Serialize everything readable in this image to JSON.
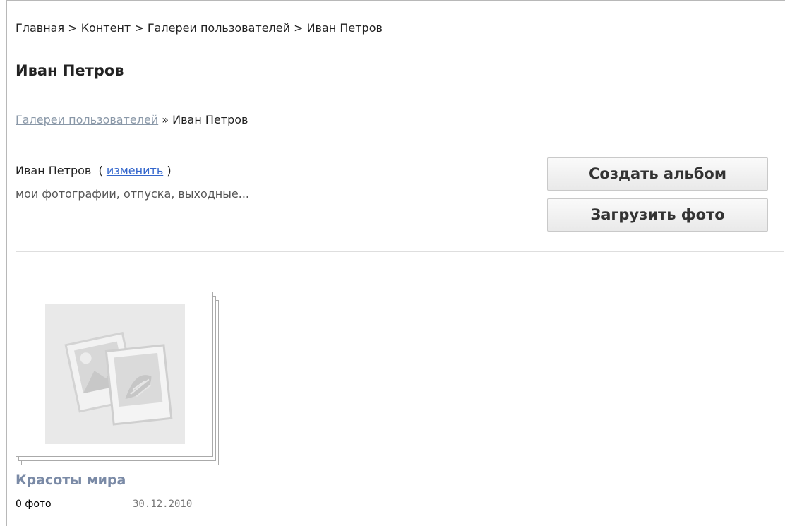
{
  "breadcrumb": {
    "text": "Главная > Контент > Галереи пользователей > Иван Петров"
  },
  "page": {
    "title": "Иван Петров"
  },
  "gallery_crumb": {
    "link_label": "Галереи пользователей",
    "separator": " » ",
    "current": "Иван Петров"
  },
  "owner": {
    "name": "Иван Петров",
    "open_paren": "  ( ",
    "edit_label": "изменить",
    "close_paren": " )",
    "description": "мои фотографии, отпуска, выходные..."
  },
  "actions": {
    "create_album_label": "Создать альбом",
    "upload_photo_label": "Загрузить фото"
  },
  "albums": [
    {
      "title": "Красоты мира",
      "count": "0 фото",
      "date": "30.12.2010",
      "thumbnail_icon": "photo-placeholder-icon"
    }
  ],
  "colors": {
    "link": "#3366cc",
    "muted_link": "#8a98a8",
    "album_title": "#7a8aa6"
  }
}
